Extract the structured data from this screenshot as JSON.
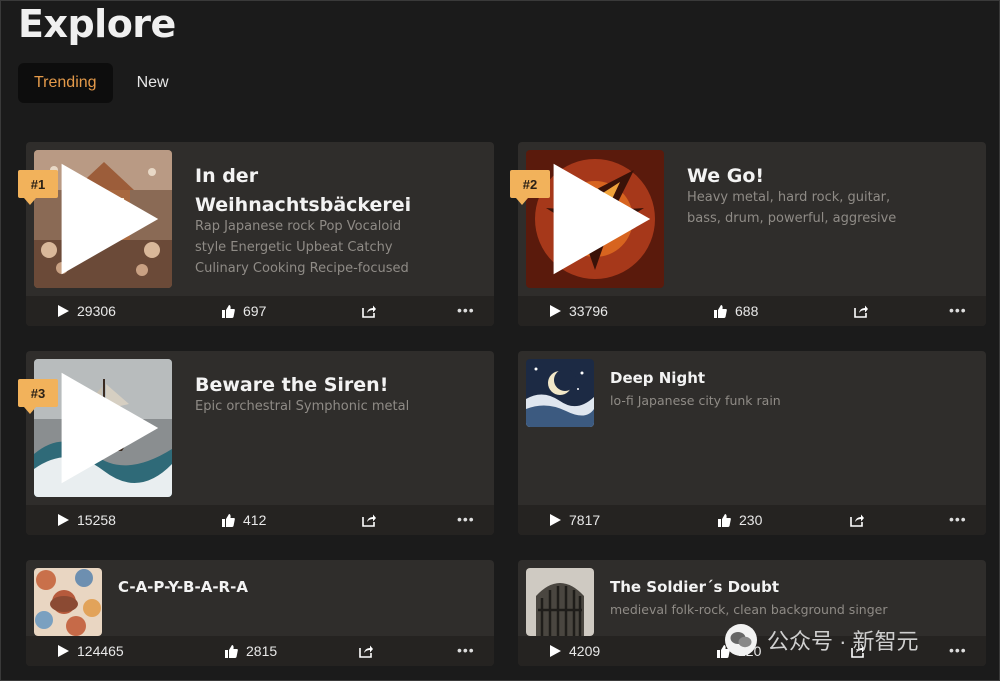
{
  "page": {
    "title": "Explore"
  },
  "tabs": [
    {
      "label": "Trending"
    },
    {
      "label": "New"
    }
  ],
  "cards": [
    {
      "rank": "#1",
      "title": "In der Weihnachtsbäckerei",
      "title_line1": "In der",
      "title_line2": "Weihnachtsbäckerei",
      "desc_line1": "Rap Japanese rock Pop Vocaloid",
      "desc_line2": "style Energetic Upbeat Catchy",
      "desc_line3": "Culinary Cooking Recipe-focused",
      "plays": "29306",
      "likes": "697",
      "art": "gingerbread-house"
    },
    {
      "rank": "#2",
      "title": "We Go!",
      "desc_line1": "Heavy metal, hard rock, guitar,",
      "desc_line2": "bass, drum, powerful, aggresive",
      "plays": "33796",
      "likes": "688",
      "art": "phoenix"
    },
    {
      "rank": "#3",
      "title": "Beware the Siren!",
      "desc_line1": "Epic orchestral Symphonic metal",
      "plays": "15258",
      "likes": "412",
      "art": "ship-in-storm"
    },
    {
      "title": "Deep Night",
      "desc_line1": "lo-fi Japanese city funk rain",
      "plays": "7817",
      "likes": "230",
      "art": "crescent-moon-night"
    },
    {
      "title": "C-A-P-Y-B-A-R-A",
      "desc_line1": "",
      "plays": "124465",
      "likes": "2815",
      "art": "capybara-pattern"
    },
    {
      "title": "The Soldier´s Doubt",
      "desc_line1": "medieval folk-rock, clean background singer",
      "plays": "4209",
      "likes": "120",
      "art": "prison-gate"
    }
  ],
  "watermark": {
    "text": "公众号 · 新智元"
  },
  "colors": {
    "accent": "#f2b25b",
    "tab_active_text": "#e49a4a",
    "card_bg": "#2f2d2b",
    "bar_bg": "#252321"
  }
}
